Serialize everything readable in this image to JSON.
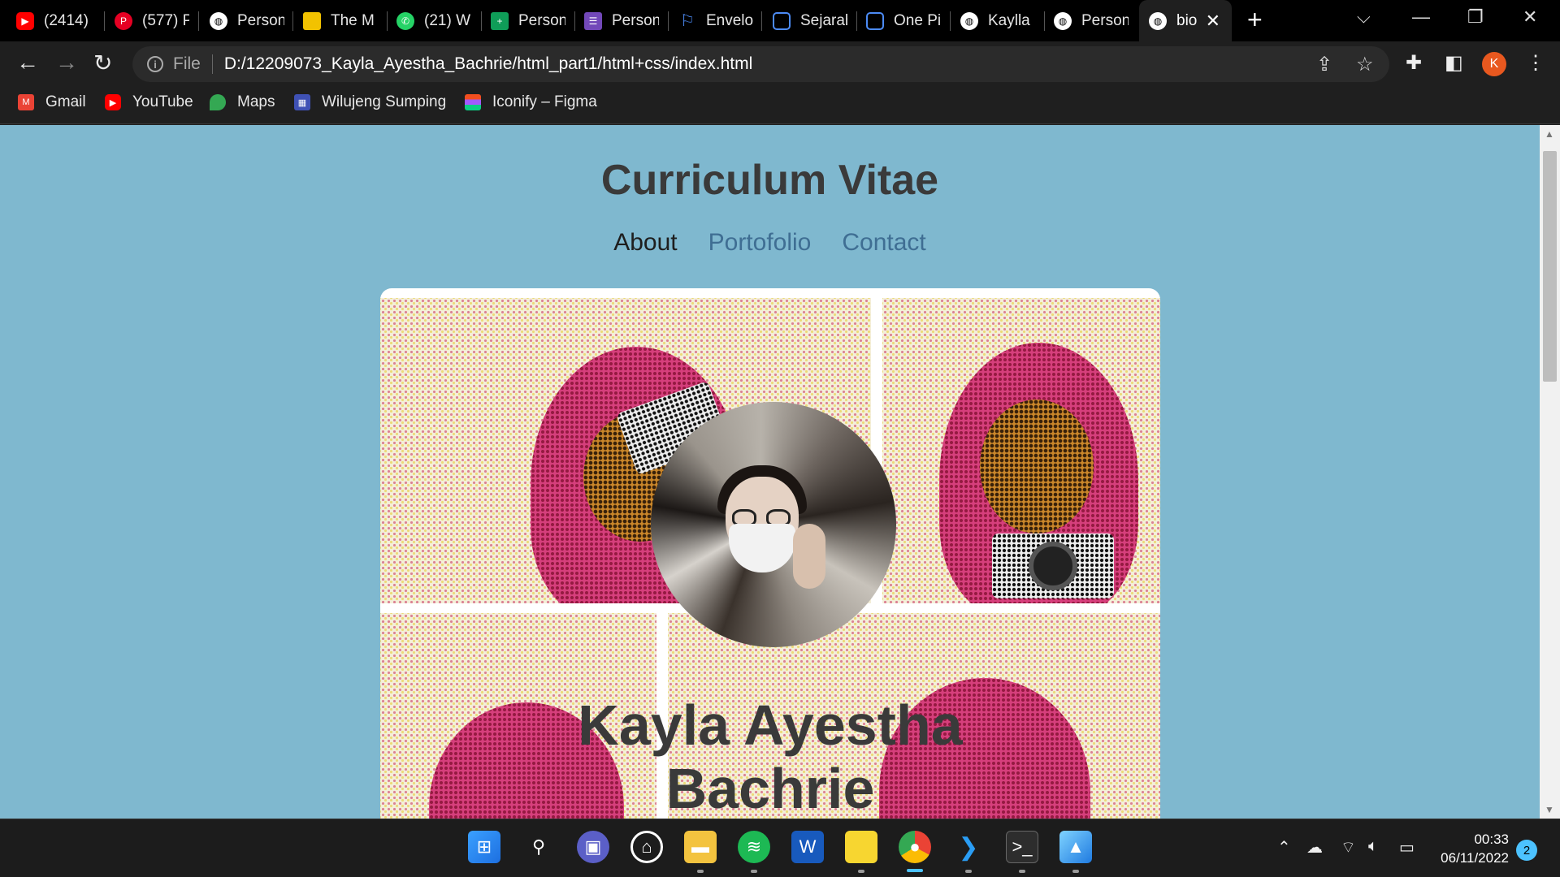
{
  "browser": {
    "tabs": [
      {
        "label": "(2414)",
        "icon": "youtube-icon",
        "color": "#ff0000"
      },
      {
        "label": "(577) P",
        "icon": "pinterest-icon",
        "color": "#e60023"
      },
      {
        "label": "Person",
        "icon": "globe-icon",
        "color": "#ffffff"
      },
      {
        "label": "The M",
        "icon": "notion-style-icon",
        "color": "#f2c200"
      },
      {
        "label": "(21) W",
        "icon": "whatsapp-icon",
        "color": "#25d366"
      },
      {
        "label": "Person",
        "icon": "sheets-icon",
        "color": "#0f9d58"
      },
      {
        "label": "Person",
        "icon": "forms-icon",
        "color": "#7248b9"
      },
      {
        "label": "Envelo",
        "icon": "flag-icon",
        "color": "#4c8bf5"
      },
      {
        "label": "Sejarah",
        "icon": "bilibili-icon",
        "color": "#4c8bf5"
      },
      {
        "label": "One Pi",
        "icon": "bilibili-icon",
        "color": "#4c8bf5"
      },
      {
        "label": "Kaylla",
        "icon": "globe-icon",
        "color": "#ffffff"
      },
      {
        "label": "Person",
        "icon": "globe-icon",
        "color": "#ffffff"
      }
    ],
    "active_tab": {
      "label": "bio",
      "icon": "globe-icon"
    },
    "address": {
      "scheme_label": "File",
      "url": "D:/12209073_Kayla_Ayestha_Bachrie/html_part1/html+css/index.html"
    },
    "profile_initial": "K",
    "bookmarks": [
      {
        "label": "Gmail",
        "icon": "gmail-icon",
        "color": "#ea4335"
      },
      {
        "label": "YouTube",
        "icon": "youtube-icon",
        "color": "#ff0000"
      },
      {
        "label": "Maps",
        "icon": "maps-pin-icon",
        "color": "#34a853"
      },
      {
        "label": "Wilujeng Sumping",
        "icon": "site-icon",
        "color": "#3f51b5"
      },
      {
        "label": "Iconify – Figma",
        "icon": "figma-icon",
        "color": "#a259ff"
      }
    ]
  },
  "page": {
    "title": "Curriculum Vitae",
    "nav": [
      {
        "label": "About",
        "current": true
      },
      {
        "label": "Portofolio",
        "current": false
      },
      {
        "label": "Contact",
        "current": false
      }
    ],
    "name_line1": "Kayla Ayestha",
    "name_line2": "Bachrie",
    "background_color": "#7fb8cf"
  },
  "taskbar": {
    "apps": [
      "windows-start-icon",
      "search-icon",
      "teams-icon",
      "github-icon",
      "file-explorer-icon",
      "spotify-icon",
      "word-icon",
      "sticky-notes-icon",
      "chrome-icon",
      "vscode-icon",
      "terminal-icon",
      "photos-icon"
    ],
    "time": "00:33",
    "date": "06/11/2022",
    "notification_count": "2"
  }
}
